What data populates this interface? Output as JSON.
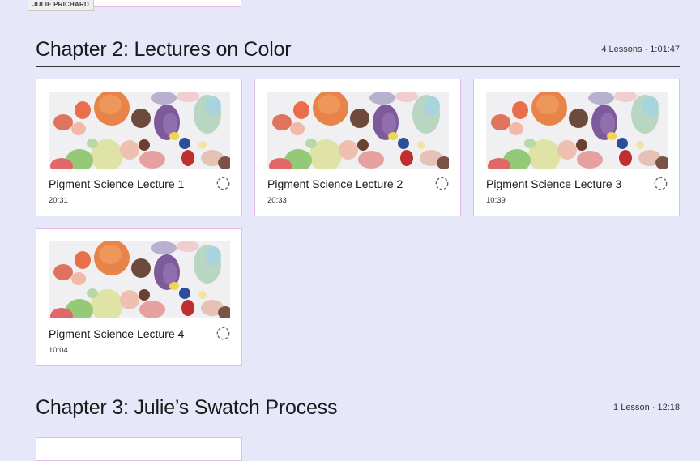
{
  "author_tag": "JULIE PRICHARD",
  "chapters": [
    {
      "title": "Chapter 2: Lectures on Color",
      "meta": "4 Lessons · 1:01:47",
      "lessons": [
        {
          "title": "Pigment Science Lecture 1",
          "duration": "20:31"
        },
        {
          "title": "Pigment Science Lecture 2",
          "duration": "20:33"
        },
        {
          "title": "Pigment Science Lecture 3",
          "duration": "10:39"
        },
        {
          "title": "Pigment Science Lecture 4",
          "duration": "10:04"
        }
      ]
    },
    {
      "title": "Chapter 3: Julie’s Swatch Process",
      "meta": "1 Lesson · 12:18",
      "lessons": []
    }
  ],
  "icons": {
    "status": "incomplete-circle-icon",
    "thumbnail": "paint-swatches-thumbnail"
  },
  "colors": {
    "background": "#e6e8fa",
    "card_border": "#e3b9e7"
  }
}
